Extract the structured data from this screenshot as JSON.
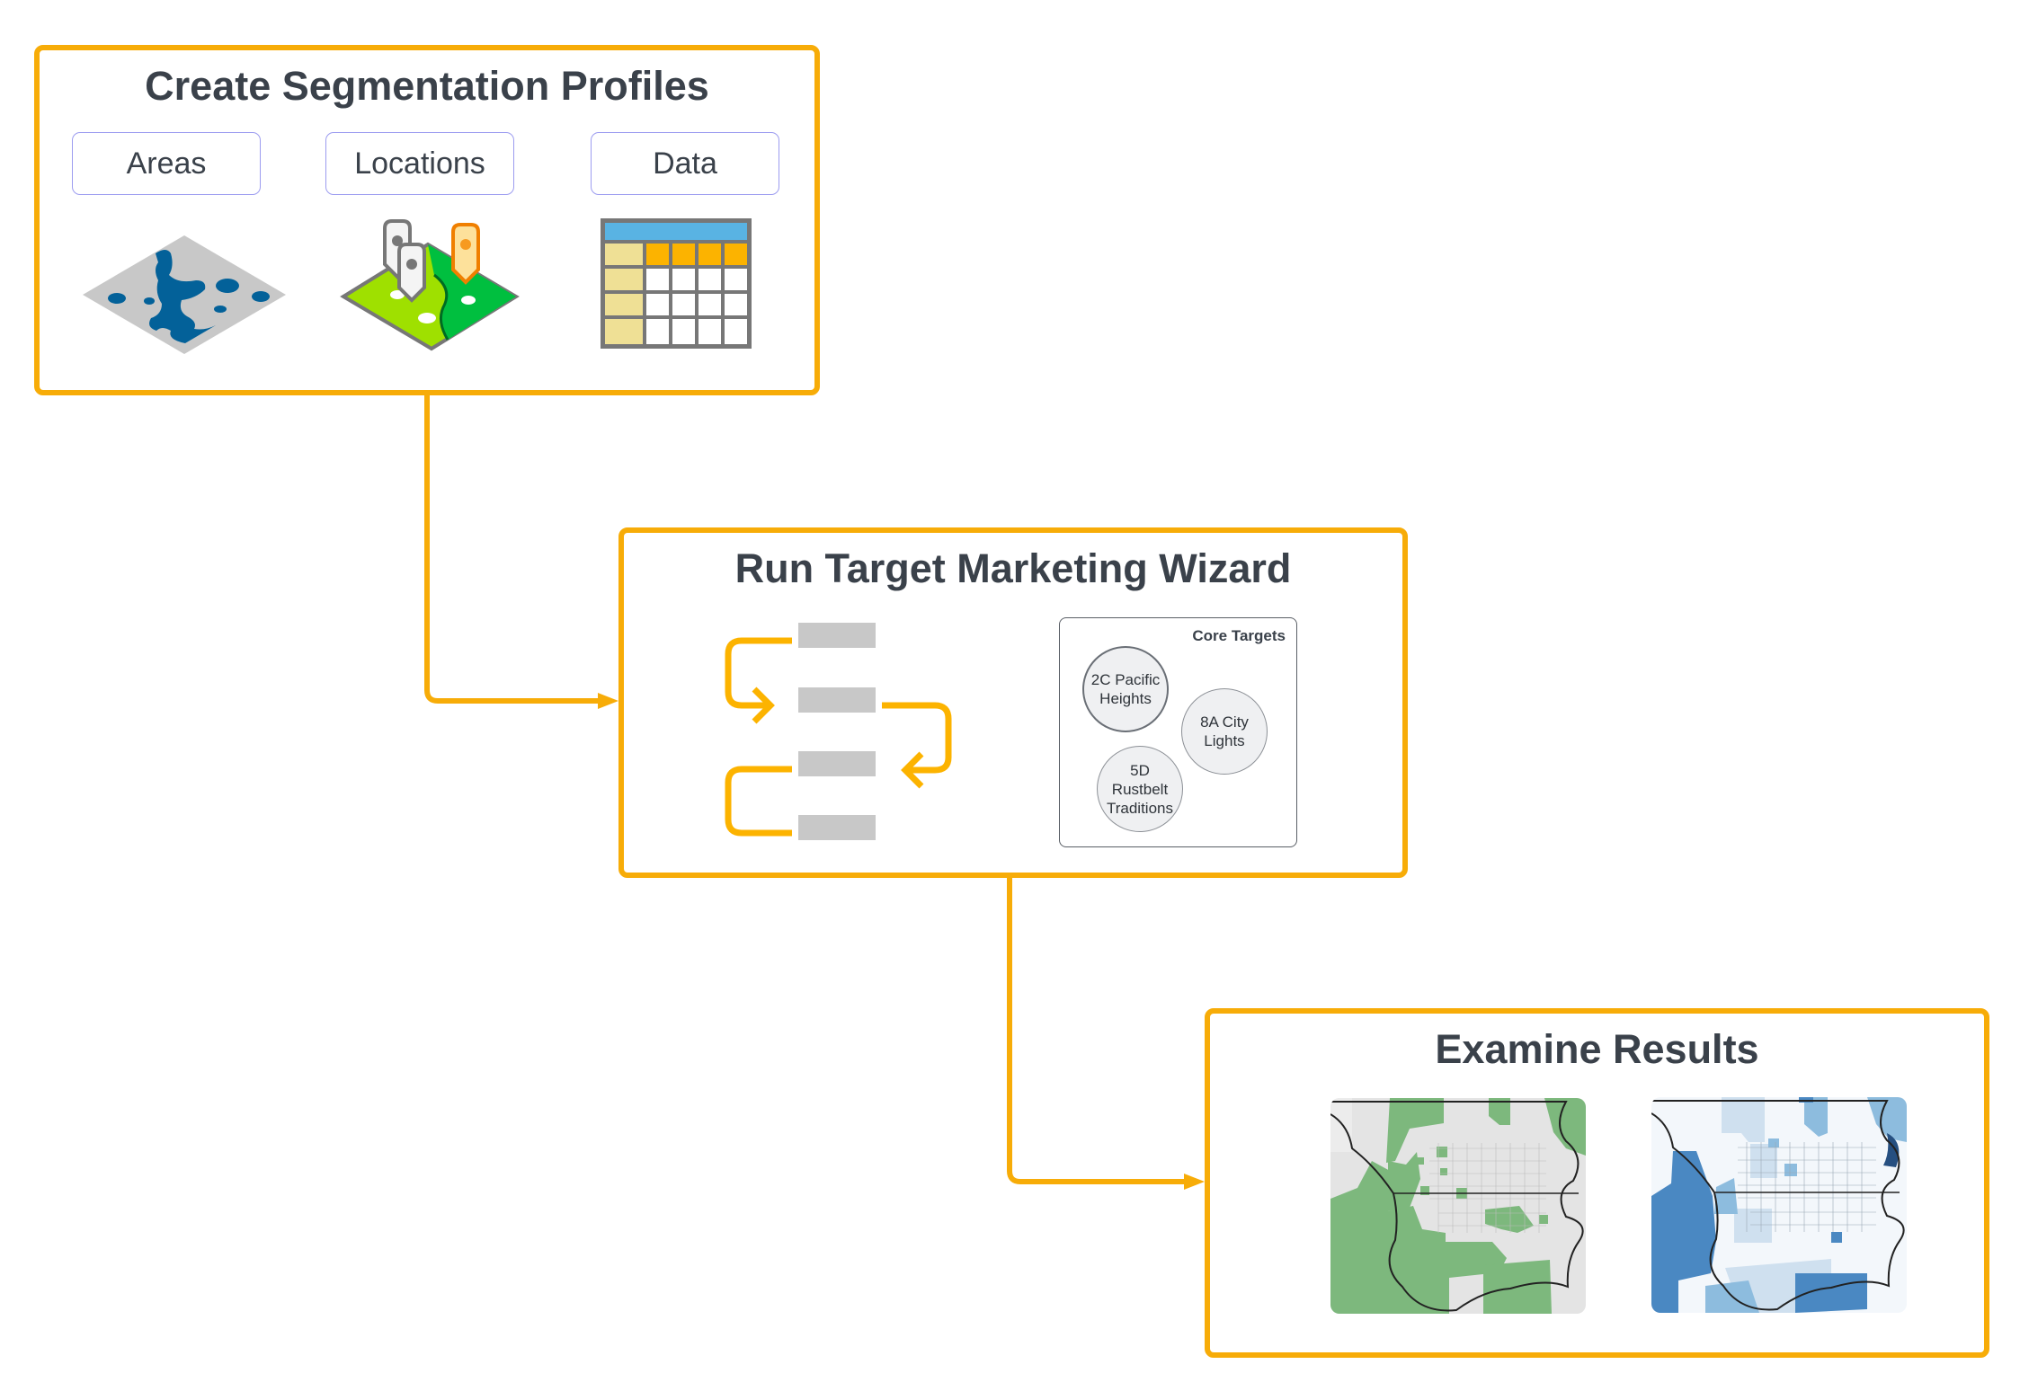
{
  "colors": {
    "accent": "#F7AC08",
    "text": "#3a414a",
    "pill_border": "#9c9cf0",
    "flow_bar": "#c8c8c8"
  },
  "stages": [
    {
      "title": "Create Segmentation Profiles",
      "options": [
        {
          "label": "Areas",
          "icon": "areas-map-icon"
        },
        {
          "label": "Locations",
          "icon": "locations-pins-icon"
        },
        {
          "label": "Data",
          "icon": "data-table-icon"
        }
      ]
    },
    {
      "title": "Run Target Marketing Wizard",
      "workflow_icon": "wizard-workflow-icon",
      "core_targets": {
        "title": "Core Targets",
        "segments": [
          {
            "line1": "2C Pacific",
            "line2": "Heights",
            "line3": ""
          },
          {
            "line1": "8A City",
            "line2": "Lights",
            "line3": ""
          },
          {
            "line1": "5D",
            "line2": "Rustbelt",
            "line3": "Traditions"
          }
        ]
      }
    },
    {
      "title": "Examine Results",
      "maps": [
        {
          "icon": "segment-map-green-icon",
          "fill": "#7db87d"
        },
        {
          "icon": "segment-map-blue-icon",
          "fill": "#4a88c2"
        }
      ]
    }
  ],
  "connectors": [
    {
      "from": "Create Segmentation Profiles",
      "to": "Run Target Marketing Wizard"
    },
    {
      "from": "Run Target Marketing Wizard",
      "to": "Examine Results"
    }
  ]
}
